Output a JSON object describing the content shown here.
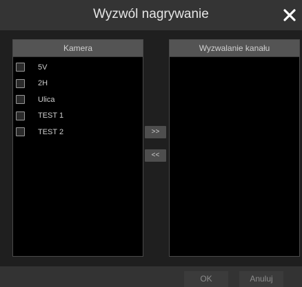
{
  "dialog": {
    "title": "Wyzwól nagrywanie",
    "close_icon": "close-icon"
  },
  "left_panel": {
    "header": "Kamera",
    "items": [
      {
        "label": "5V",
        "checked": false
      },
      {
        "label": "2H",
        "checked": false
      },
      {
        "label": "Ulica",
        "checked": false
      },
      {
        "label": "TEST 1",
        "checked": false
      },
      {
        "label": "TEST 2",
        "checked": false
      }
    ]
  },
  "right_panel": {
    "header": "Wyzwalanie kanału",
    "items": []
  },
  "transfer": {
    "add_label": ">>",
    "remove_label": "<<"
  },
  "footer": {
    "ok_label": "OK",
    "cancel_label": "Anuluj"
  }
}
